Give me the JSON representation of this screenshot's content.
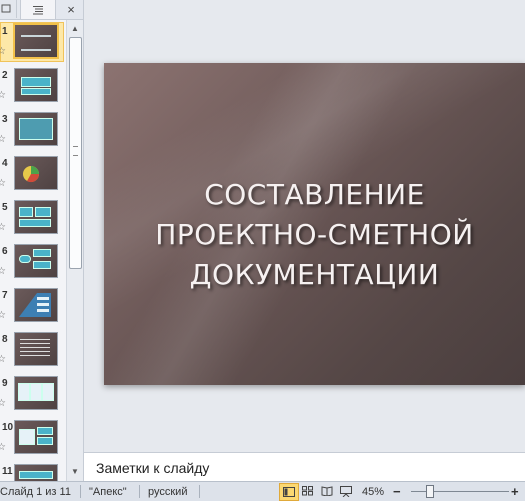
{
  "thumbnails": [
    {
      "number": "1",
      "selected": true
    },
    {
      "number": "2"
    },
    {
      "number": "3"
    },
    {
      "number": "4"
    },
    {
      "number": "5"
    },
    {
      "number": "6"
    },
    {
      "number": "7"
    },
    {
      "number": "8"
    },
    {
      "number": "9"
    },
    {
      "number": "10"
    },
    {
      "number": "11"
    }
  ],
  "slide": {
    "title": "СОСТАВЛЕНИЕ\nПРОЕКТНО-СМЕТНОЙ\nДОКУМЕНТАЦИИ"
  },
  "notes": {
    "text": "Заметки к слайду"
  },
  "statusbar": {
    "slide_info": "Слайд 1 из 11",
    "theme": "\"Апекс\"",
    "language": "русский",
    "zoom": "45%",
    "zoom_out": "−",
    "zoom_in": "+"
  },
  "icons": {
    "star": "☆",
    "close": "×",
    "scroll_up": "▲",
    "scroll_down": "▼"
  }
}
